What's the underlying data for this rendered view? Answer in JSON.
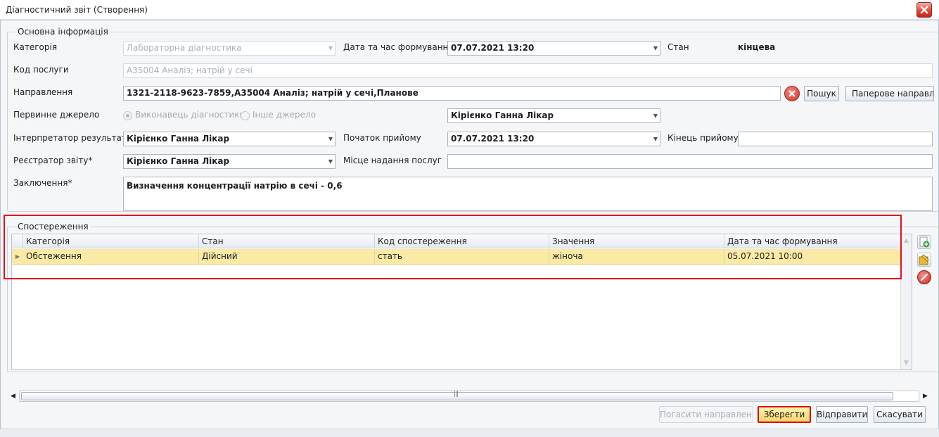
{
  "window": {
    "title": "Діагностичний звіт (Створення)"
  },
  "basic": {
    "legend": "Основна інформація",
    "category": {
      "label": "Категорія",
      "value": "Лабораторна діагностика"
    },
    "datetime": {
      "label": "Дата та час формування*",
      "value": "07.07.2021 13:20"
    },
    "status": {
      "label": "Стан",
      "value": "кінцева"
    },
    "service_code": {
      "label": "Код послуги",
      "value": "A35004 Аналіз; натрій у сечі"
    },
    "referral": {
      "label": "Направлення",
      "value": "1321-2118-9623-7859,A35004 Аналіз; натрій у сечі,Планове",
      "search_label": "Пошук",
      "paper_label": "Паперове направлення"
    },
    "primary_source": {
      "label": "Первинне джерело",
      "option1": "Виконавець діагностики",
      "option2": "Інше джерело",
      "performer": "Кірієнко Ганна Лікар"
    },
    "interpreter": {
      "label": "Інтерпретатор результату*",
      "value": "Кірієнко Ганна Лікар"
    },
    "start": {
      "label": "Початок прийому",
      "value": "07.07.2021 13:20"
    },
    "end": {
      "label": "Кінець прийому",
      "value": ""
    },
    "registrar": {
      "label": "Реєстратор звіту*",
      "value": "Кірієнко Ганна Лікар"
    },
    "place": {
      "label": "Місце надання послуг",
      "value": ""
    },
    "conclusion": {
      "label": "Заключення*",
      "value": "Визначення концентрації натрію в сечі - 0,6"
    }
  },
  "observations": {
    "legend": "Спостереження",
    "columns": [
      "Категорія",
      "Стан",
      "Код спостереження",
      "Значення",
      "Дата та час формування"
    ],
    "rows": [
      {
        "category": "Обстеження",
        "status": "Дійсний",
        "code": "стать",
        "value": "жіноча",
        "datetime": "05.07.2021 10:00"
      }
    ]
  },
  "footer": {
    "cancel_referral": "Погасити направлення",
    "save": "Зберегти",
    "send": "Відправити",
    "cancel": "Скасувати"
  },
  "icons": {
    "close": "close-icon",
    "clear": "clear-icon",
    "add": "add-icon",
    "edit": "edit-icon",
    "delete": "delete-icon"
  },
  "colors": {
    "highlight": "#e2111b",
    "selected_row": "#fbe9a6",
    "close_red": "#e0483a"
  }
}
